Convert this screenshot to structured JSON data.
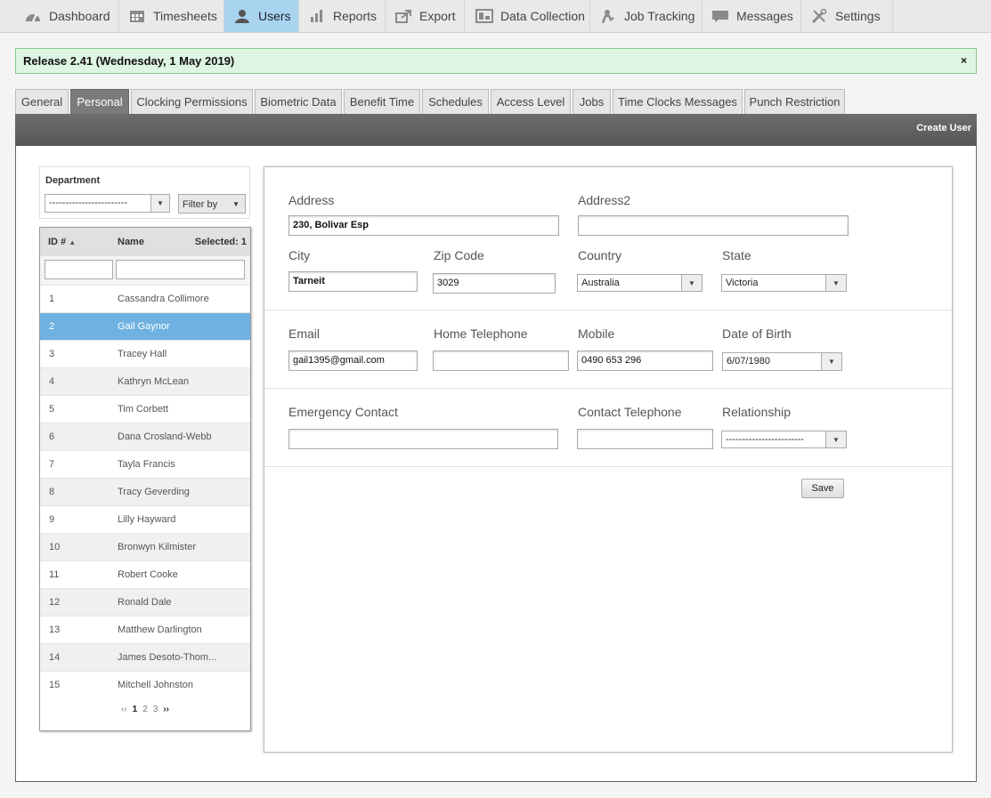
{
  "nav": {
    "items": [
      {
        "label": "Dashboard",
        "icon": "dashboard-icon"
      },
      {
        "label": "Timesheets",
        "icon": "calendar-icon"
      },
      {
        "label": "Users",
        "icon": "user-icon"
      },
      {
        "label": "Reports",
        "icon": "bar-chart-icon"
      },
      {
        "label": "Export",
        "icon": "export-icon"
      },
      {
        "label": "Data Collection",
        "icon": "data-collection-icon"
      },
      {
        "label": "Job Tracking",
        "icon": "job-tracking-icon"
      },
      {
        "label": "Messages",
        "icon": "message-icon"
      },
      {
        "label": "Settings",
        "icon": "settings-tools-icon"
      }
    ],
    "active": "Users"
  },
  "release": {
    "text": "Release 2.41 (Wednesday, 1 May 2019)",
    "close": "×"
  },
  "tabs": [
    "General",
    "Personal",
    "Clocking Permissions",
    "Biometric Data",
    "Benefit Time",
    "Schedules",
    "Access Level",
    "Jobs",
    "Time Clocks Messages",
    "Punch Restriction"
  ],
  "active_tab": "Personal",
  "toolbar": {
    "create_user": "Create User"
  },
  "department": {
    "label": "Department",
    "value": "------------------------",
    "filter_label": "Filter by"
  },
  "userlist": {
    "col_id": "ID #",
    "col_name": "Name",
    "selected": "Selected: 1",
    "rows": [
      {
        "id": "1",
        "name": "Cassandra Collimore"
      },
      {
        "id": "2",
        "name": "Gail Gaynor"
      },
      {
        "id": "3",
        "name": "Tracey Hall"
      },
      {
        "id": "4",
        "name": "Kathryn McLean"
      },
      {
        "id": "5",
        "name": "Tim Corbett"
      },
      {
        "id": "6",
        "name": "Dana Crosland-Webb"
      },
      {
        "id": "7",
        "name": "Tayla Francis"
      },
      {
        "id": "8",
        "name": "Tracy Geverding"
      },
      {
        "id": "9",
        "name": "Lilly Hayward"
      },
      {
        "id": "10",
        "name": "Bronwyn Kilmister"
      },
      {
        "id": "11",
        "name": "Robert Cooke"
      },
      {
        "id": "12",
        "name": "Ronald Dale"
      },
      {
        "id": "13",
        "name": "Matthew Darlington"
      },
      {
        "id": "14",
        "name": "James Desoto-Thom..."
      },
      {
        "id": "15",
        "name": "Mitchell Johnston"
      }
    ],
    "selected_row": "2",
    "pager": {
      "prev": "‹‹",
      "pages": [
        "1",
        "2",
        "3"
      ],
      "current": "1",
      "next": "››"
    }
  },
  "form": {
    "address": {
      "label": "Address",
      "value": "230, Bolivar Esp"
    },
    "address2": {
      "label": "Address2",
      "value": ""
    },
    "city": {
      "label": "City",
      "value": "Tarneit"
    },
    "zip": {
      "label": "Zip Code",
      "value": "3029"
    },
    "country": {
      "label": "Country",
      "value": "Australia"
    },
    "state": {
      "label": "State",
      "value": "Victoria"
    },
    "email": {
      "label": "Email",
      "value": "gail1395@gmail.com"
    },
    "home_phone": {
      "label": "Home Telephone",
      "value": ""
    },
    "mobile": {
      "label": "Mobile",
      "value": "0490 653 296"
    },
    "dob": {
      "label": "Date of Birth",
      "value": "6/07/1980"
    },
    "emergency_contact": {
      "label": "Emergency Contact",
      "value": ""
    },
    "contact_phone": {
      "label": "Contact Telephone",
      "value": ""
    },
    "relationship": {
      "label": "Relationship",
      "value": "------------------------"
    },
    "save": "Save"
  },
  "colors": {
    "active_nav": "#a9d4ef",
    "selected_row": "#6fb1e0",
    "release_bg": "#dff5e3",
    "toolbar": "#5f5f5f"
  }
}
